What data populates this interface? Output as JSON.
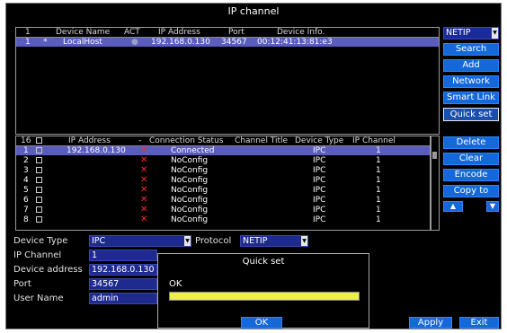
{
  "window": {
    "title": "IP channel"
  },
  "device_table": {
    "headers": {
      "num": "1",
      "name": "Device Name",
      "act": "ACT",
      "ip": "IP Address",
      "port": "Port",
      "info": "Device Info."
    },
    "rows": [
      {
        "num": "1",
        "mark": "*",
        "name": "LocalHost",
        "act": "●",
        "ip": "192.168.0.130",
        "port": "34567",
        "info": "00:12:41:13:81:e3"
      }
    ]
  },
  "protocol_select": {
    "value": "NETIP"
  },
  "right_buttons": {
    "search": "Search",
    "add": "Add",
    "network": "Network",
    "smart_link": "Smart Link",
    "quick_set": "Quick set",
    "delete": "Delete",
    "clear": "Clear",
    "encode": "Encode",
    "copy_to": "Copy to",
    "up": "▲",
    "down": "▼"
  },
  "channel_table": {
    "headers": {
      "num": "16",
      "ip": "IP Address",
      "dash": "-",
      "status": "Connection Status",
      "title": "Channel Title",
      "type": "Device Type",
      "channel": "IP Channel"
    },
    "rows": [
      {
        "num": "1",
        "ip": "192.168.0.130",
        "status": "Connected",
        "title": "",
        "type": "IPC",
        "channel": "1"
      },
      {
        "num": "2",
        "ip": "",
        "status": "NoConfig",
        "title": "",
        "type": "IPC",
        "channel": "1"
      },
      {
        "num": "3",
        "ip": "",
        "status": "NoConfig",
        "title": "",
        "type": "IPC",
        "channel": "1"
      },
      {
        "num": "4",
        "ip": "",
        "status": "NoConfig",
        "title": "",
        "type": "IPC",
        "channel": "1"
      },
      {
        "num": "5",
        "ip": "",
        "status": "NoConfig",
        "title": "",
        "type": "IPC",
        "channel": "1"
      },
      {
        "num": "6",
        "ip": "",
        "status": "NoConfig",
        "title": "",
        "type": "IPC",
        "channel": "1"
      },
      {
        "num": "7",
        "ip": "",
        "status": "NoConfig",
        "title": "",
        "type": "IPC",
        "channel": "1"
      },
      {
        "num": "8",
        "ip": "",
        "status": "NoConfig",
        "title": "",
        "type": "IPC",
        "channel": "1"
      }
    ]
  },
  "form": {
    "device_type_label": "Device Type",
    "device_type_value": "IPC",
    "protocol_label": "Protocol",
    "protocol_value": "NETIP",
    "ip_channel_label": "IP Channel",
    "ip_channel_value": "1",
    "device_address_label": "Device address",
    "device_address_value": "192.168.0.130",
    "port_label": "Port",
    "port_value": "34567",
    "user_name_label": "User Name",
    "user_name_value": "admin"
  },
  "dialog": {
    "title": "Quick set",
    "message": "OK",
    "progress": 1.0,
    "ok_label": "OK"
  },
  "footer": {
    "apply": "Apply",
    "exit": "Exit"
  },
  "colors": {
    "accent": "#1468d8",
    "selection": "#5a5cc0",
    "progress_fill": "#f0f040",
    "error": "#ff2a2a"
  }
}
